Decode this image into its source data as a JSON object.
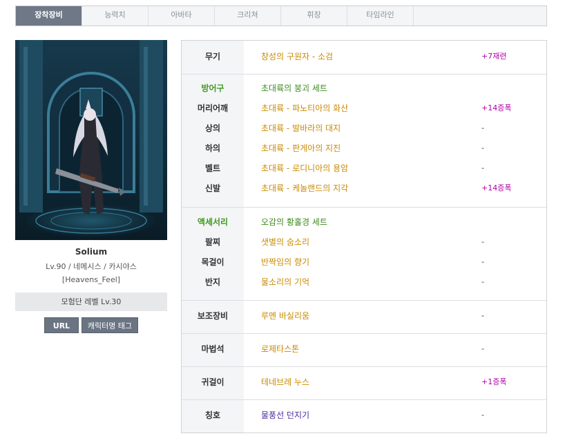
{
  "tabs": [
    {
      "label": "장착장비",
      "active": true
    },
    {
      "label": "능력치"
    },
    {
      "label": "아바타"
    },
    {
      "label": "크리쳐"
    },
    {
      "label": "휘장"
    },
    {
      "label": "타임라인"
    }
  ],
  "character": {
    "name": "Solium",
    "info": "Lv.90 / 네메시스 / 카시야스",
    "guild": "[Heavens_Feel]",
    "adventure_level": "모험단 레벨 Lv.30",
    "url_button": "URL",
    "tag_button": "캐릭터명 태그"
  },
  "equipment": {
    "weapon": {
      "slot": "무기",
      "item": "창성의 구원자 - 소검",
      "option": "+7재련"
    },
    "armor": {
      "header": "방어구",
      "set": "초대륙의 붕괴 세트",
      "rows": [
        {
          "slot": "머리어깨",
          "item": "초대륙 - 파노티아의 화산",
          "option": "+14증폭"
        },
        {
          "slot": "상의",
          "item": "초대륙 - 발바라의 대지",
          "option": "-"
        },
        {
          "slot": "하의",
          "item": "초대륙 - 판게아의 지진",
          "option": "-"
        },
        {
          "slot": "벨트",
          "item": "초대륙 - 로디니아의 용암",
          "option": "-"
        },
        {
          "slot": "신발",
          "item": "초대륙 - 케놀랜드의 지각",
          "option": "+14증폭"
        }
      ]
    },
    "accessory": {
      "header": "액세서리",
      "set": "오감의 황홀경 세트",
      "rows": [
        {
          "slot": "팔찌",
          "item": "샛별의 숨소리",
          "option": "-"
        },
        {
          "slot": "목걸이",
          "item": "반짝임의 향기",
          "option": "-"
        },
        {
          "slot": "반지",
          "item": "물소리의 기억",
          "option": "-"
        }
      ]
    },
    "sub": {
      "slot": "보조장비",
      "item": "루멘 바실리움",
      "option": "-"
    },
    "magic_stone": {
      "slot": "마법석",
      "item": "로제타스톤",
      "option": "-"
    },
    "earring": {
      "slot": "귀걸이",
      "item": "테네브레 누스",
      "option": "+1증폭"
    },
    "title": {
      "slot": "칭호",
      "item": "물풍선 던지기",
      "option": "-"
    }
  },
  "colors": {
    "tab_active": "#6f7886",
    "item_gold": "#c98a00",
    "set_green": "#3e8a1e",
    "option_purple": "#b100a6",
    "title_purple": "#4a2aa0"
  }
}
